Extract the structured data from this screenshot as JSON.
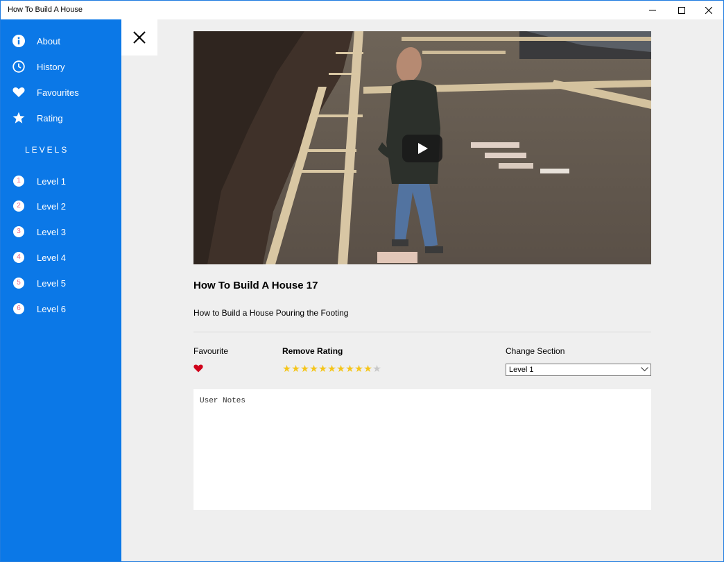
{
  "window": {
    "title": "How To Build A House",
    "controls": [
      "minimize-icon",
      "maximize-icon",
      "close-icon"
    ]
  },
  "sidebar": {
    "items": [
      {
        "label": "About",
        "icon": "info-icon"
      },
      {
        "label": "History",
        "icon": "clock-icon"
      },
      {
        "label": "Favourites",
        "icon": "heart-icon"
      },
      {
        "label": "Rating",
        "icon": "star-icon"
      }
    ],
    "levels_heading": "LEVELS",
    "levels": [
      {
        "num": "1",
        "label": "Level 1"
      },
      {
        "num": "2",
        "label": "Level 2"
      },
      {
        "num": "3",
        "label": "Level 3"
      },
      {
        "num": "4",
        "label": "Level 4"
      },
      {
        "num": "5",
        "label": "Level 5"
      },
      {
        "num": "6",
        "label": "Level 6"
      }
    ]
  },
  "video": {
    "title": "How To Build A House 17",
    "description": "How to Build a House Pouring the Footing"
  },
  "details": {
    "favourite_label": "Favourite",
    "favourite": true,
    "rating_label": "Remove Rating",
    "rating": 10,
    "rating_max": 11,
    "section_label": "Change Section",
    "section_value": "Level 1"
  },
  "notes": {
    "text": "User Notes"
  },
  "colors": {
    "sidebar": "#0b78e7",
    "heart": "#d0021b",
    "star_filled": "#f5c518",
    "star_empty": "#c8c8c8",
    "level_number": "#ee6a8f"
  }
}
